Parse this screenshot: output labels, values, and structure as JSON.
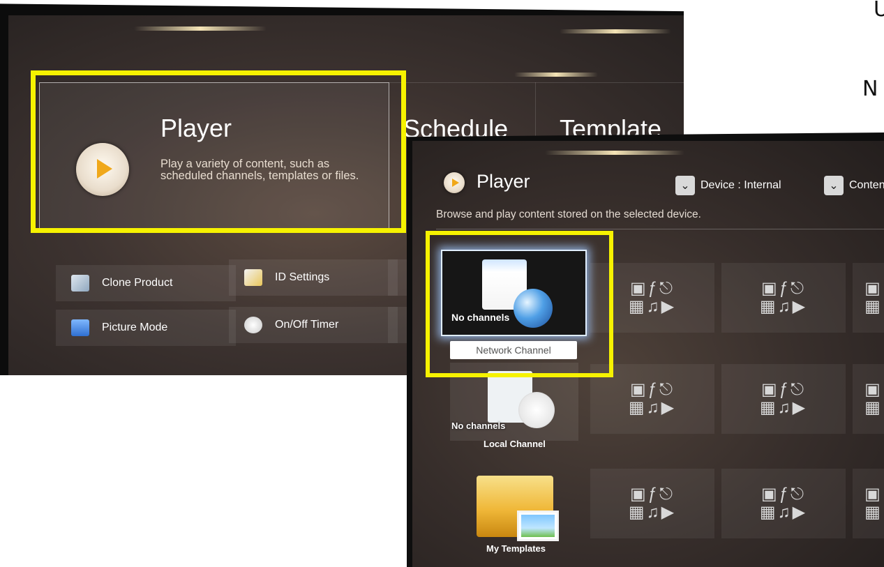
{
  "edge_text": {
    "top": "U",
    "mid": "N"
  },
  "main_menu": {
    "player": {
      "title": "Player",
      "description": "Play a variety of content, such as scheduled channels, templates or files."
    },
    "tabs": [
      "Schedule",
      "Template"
    ]
  },
  "tools": {
    "clone_product": "Clone Product",
    "id_settings": "ID Settings",
    "picture_mode": "Picture Mode",
    "on_off_timer": "On/Off Timer"
  },
  "player_screen": {
    "title": "Player",
    "subtitle": "Browse and play content stored on the selected device.",
    "device_dropdown": "Device : Internal",
    "content_dropdown": "Conten"
  },
  "channels": {
    "network": {
      "status": "No channels",
      "label": "Network Channel"
    },
    "local": {
      "status": "No channels",
      "label": "Local Channel"
    },
    "templates": {
      "label": "My Templates"
    }
  },
  "media_icons": {
    "row1": [
      "photo-icon",
      "flash-icon",
      "usb-icon"
    ],
    "row2": [
      "slideshow-icon",
      "music-icon",
      "video-icon"
    ]
  },
  "highlight_color": "#f6f200"
}
